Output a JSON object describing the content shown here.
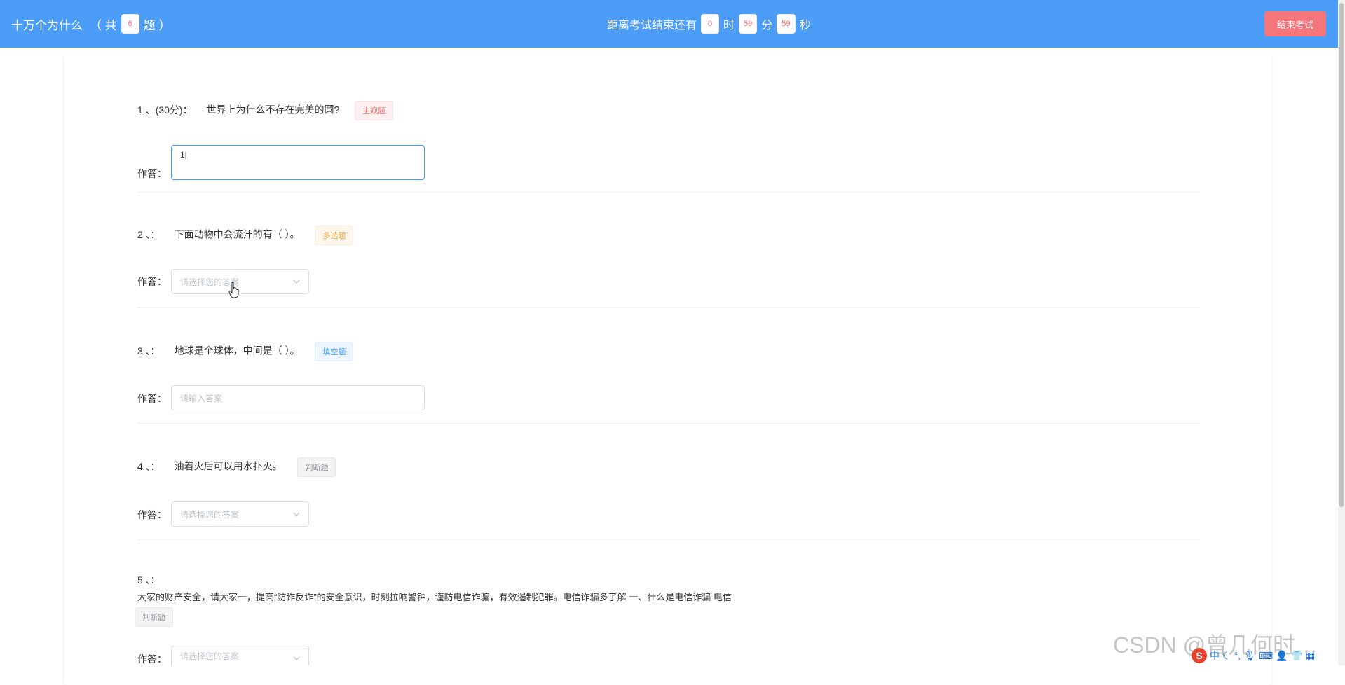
{
  "header": {
    "title": "十万个为什么",
    "count_prefix": "（ 共",
    "count_value": "6",
    "count_suffix": "题 ）",
    "timer_prefix": "距离考试结束还有",
    "hours": "0",
    "hours_unit": "时",
    "minutes": "59",
    "minutes_unit": "分",
    "seconds": "59",
    "seconds_unit": "秒",
    "end_button": "结束考试"
  },
  "answer_label": "作答：",
  "questions": [
    {
      "number": "1 、(30分)：",
      "text": "世界上为什么不存在完美的圆?",
      "tag": "主观题",
      "answer_value": "1|"
    },
    {
      "number": "2 、：",
      "text": "下面动物中会流汗的有（ ）。",
      "tag": "多选题",
      "placeholder": "请选择您的答案"
    },
    {
      "number": "3 、：",
      "text": "地球是个球体，中间是（ ）。",
      "tag": "填空题",
      "placeholder": "请输入答案"
    },
    {
      "number": "4 、：",
      "text": "油着火后可以用水扑灭。",
      "tag": "判断题",
      "placeholder": "请选择您的答案"
    },
    {
      "number": "5 、：",
      "text": "大家的财产安全，请大家一，提高“防诈反诈”的安全意识，时刻拉响警钟，谨防电信诈骗，有效遏制犯罪。电信诈骗多了解 一、什么是电信诈骗 电信",
      "tag": "判断题",
      "placeholder": "请选择您的答案"
    }
  ],
  "watermark": "CSDN @曾几何时…",
  "ime": {
    "lang": "中",
    "icons": [
      "moon-icon",
      "punctuation-icon",
      "mic-icon",
      "keyboard-icon",
      "user-icon",
      "shirt-icon",
      "grid-icon"
    ]
  },
  "colors": {
    "header_bg": "#4c9df7",
    "end_button_bg": "#f4757a",
    "active_border": "#409eff"
  }
}
